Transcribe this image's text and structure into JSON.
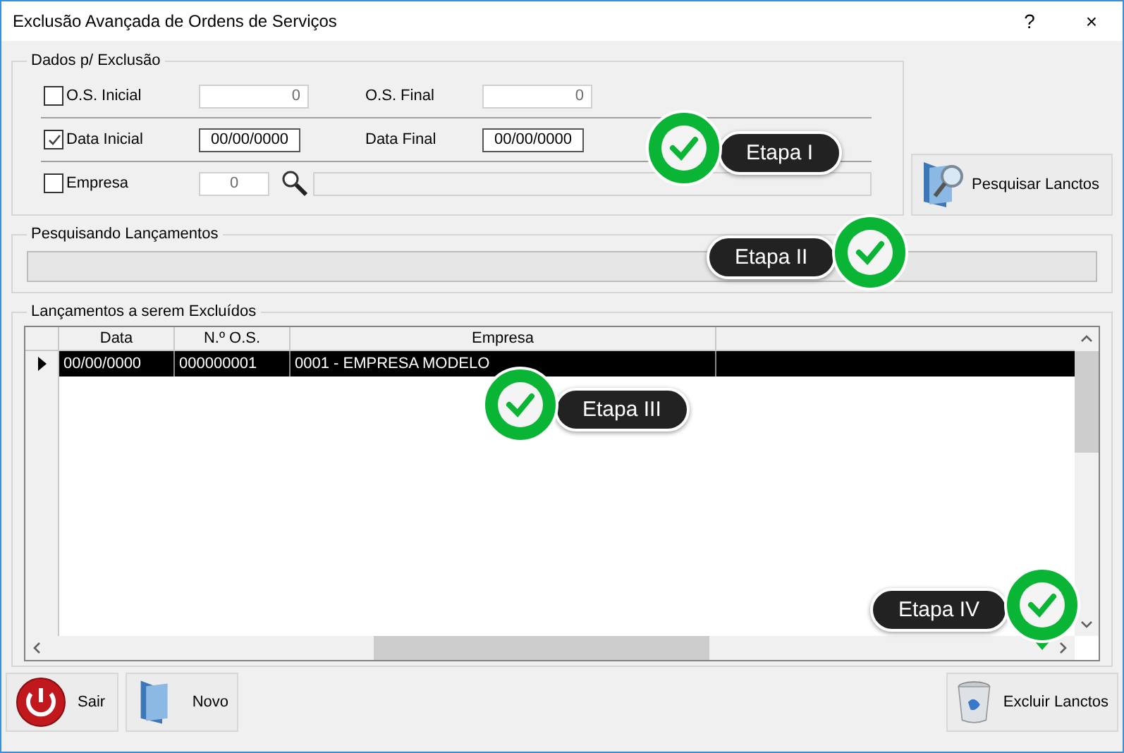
{
  "window": {
    "title": "Exclusão Avançada de Ordens de Serviços",
    "help": "?",
    "close": "×"
  },
  "filters": {
    "title": "Dados p/ Exclusão",
    "os_inicial": {
      "label": "O.S. Inicial",
      "checked": false,
      "disabled": true,
      "value": "0"
    },
    "os_final": {
      "label": "O.S. Final",
      "disabled": true,
      "value": "0"
    },
    "data_inicial": {
      "label": "Data Inicial",
      "checked": true,
      "value": "00/00/0000"
    },
    "data_final": {
      "label": "Data Final",
      "value": "00/00/0000"
    },
    "empresa": {
      "label": "Empresa",
      "checked": false,
      "disabled": true,
      "value": "0"
    }
  },
  "search_button": "Pesquisar Lanctos",
  "progress": {
    "title": "Pesquisando Lançamentos",
    "level": 0
  },
  "results": {
    "title": "Lançamentos a serem Excluídos",
    "columns": [
      "Data",
      "N.º O.S.",
      "Empresa"
    ],
    "rows": [
      {
        "selected": true,
        "cells": [
          "00/00/0000",
          "000000001",
          "0001 - EMPRESA MODELO"
        ]
      }
    ]
  },
  "buttons": [
    {
      "kind": "exit",
      "label": "Sair"
    },
    {
      "kind": "new",
      "label": "Novo"
    },
    {
      "kind": "delete",
      "label": "Excluir Lanctos"
    }
  ],
  "callouts": [
    {
      "label": "Etapa I"
    },
    {
      "label": "Etapa II"
    },
    {
      "label": "Etapa III"
    },
    {
      "label": "Etapa IV"
    }
  ]
}
